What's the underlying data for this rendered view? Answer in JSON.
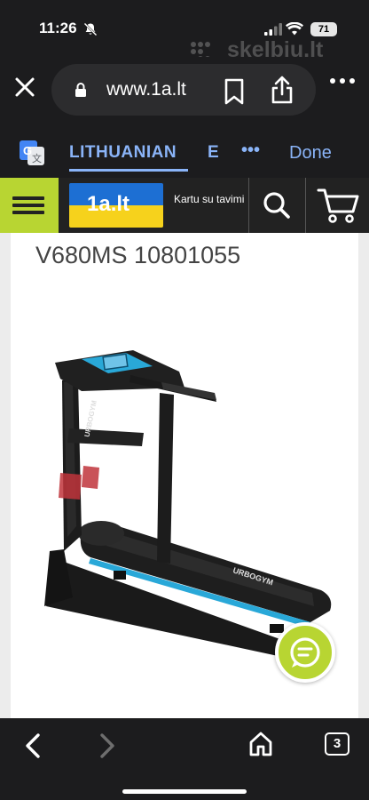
{
  "status_bar": {
    "time": "11:26",
    "battery": "71"
  },
  "watermark": {
    "text": "skelbiu.lt"
  },
  "browser": {
    "url": "www.1a.lt"
  },
  "translate_bar": {
    "active_language": "LITHUANIAN",
    "next_language": "E",
    "more_label": "•••",
    "done_label": "Done"
  },
  "site_header": {
    "logo_text": "1a.lt",
    "tagline": "Kartu su tavimi"
  },
  "product": {
    "title": "V680MS 10801055",
    "image_brand_text": "URBOGYM"
  },
  "bottom_bar": {
    "tab_count": "3"
  },
  "colors": {
    "accent_green": "#b8d532",
    "link_blue": "#8ab4f8",
    "flag_blue": "#1d6fd3",
    "flag_yellow": "#f6d21c"
  }
}
